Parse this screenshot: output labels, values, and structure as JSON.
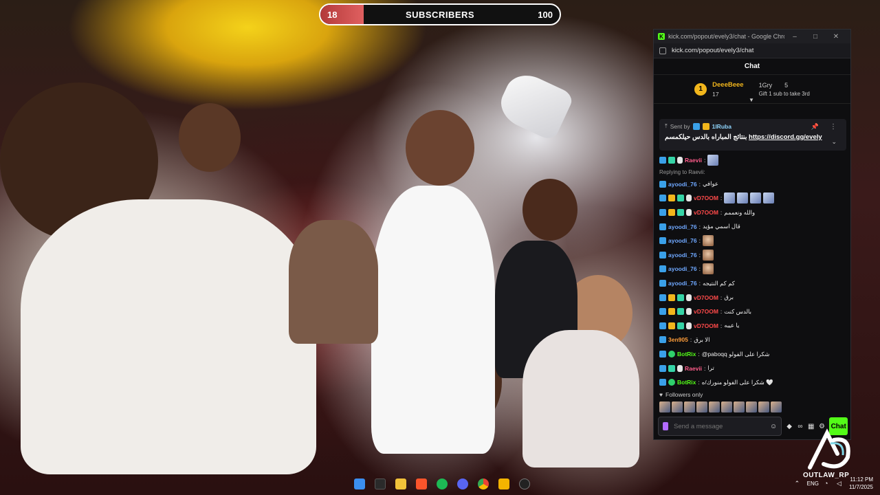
{
  "overlay": {
    "subscribers": {
      "current": "18",
      "label": "SUBSCRIBERS",
      "goal": "100",
      "progress_fraction": 0.18
    }
  },
  "browser": {
    "window_title": "kick.com/popout/evely3/chat - Google Chrome",
    "url": "kick.com/popout/evely3/chat",
    "controls": {
      "minimize": "–",
      "maximize": "□",
      "close": "✕"
    }
  },
  "chat": {
    "header": "Chat",
    "leaderboard": {
      "rank": "1",
      "top_name": "DeeeBeee",
      "top_count": "17",
      "second_name": "1Gry",
      "second_count": "5",
      "gift_text": "Gift 1 sub to take 3rd"
    },
    "pinned": {
      "sent_by_label": "Sent by",
      "user": "1lRuba",
      "message_text": "بنتائج المباراه بالدس حيلكمسم ",
      "link": "https://discord.gg/evely"
    },
    "messages": [
      {
        "user": "Raevii",
        "color": "u-pink",
        "text": "",
        "emotes": 1
      },
      {
        "reply": "Replying to Raevii:",
        "user": "ayoodi_76",
        "color": "u-blue",
        "text": "عوافي"
      },
      {
        "user": "vD7OOM",
        "color": "u-red",
        "text": "",
        "emotes": 4
      },
      {
        "user": "vD7OOM",
        "color": "u-red",
        "text": "والله ونعممم"
      },
      {
        "user": "ayoodi_76",
        "color": "u-blue",
        "text": "قال اسمي مؤيد"
      },
      {
        "user": "ayoodi_76",
        "color": "u-blue",
        "text": "",
        "faces": 1
      },
      {
        "user": "ayoodi_76",
        "color": "u-blue",
        "text": "",
        "faces": 1
      },
      {
        "user": "ayoodi_76",
        "color": "u-blue",
        "text": "",
        "faces": 1
      },
      {
        "user": "ayoodi_76",
        "color": "u-blue",
        "text": "كم كم النتيجه"
      },
      {
        "user": "vD7OOM",
        "color": "u-red",
        "text": "برق"
      },
      {
        "user": "vD7OOM",
        "color": "u-red",
        "text": "بالدس كنت"
      },
      {
        "user": "vD7OOM",
        "color": "u-red",
        "text": "يا عيبه"
      },
      {
        "user": "3en905",
        "color": "u-orange",
        "text": "الا برق"
      },
      {
        "user": "BotRix",
        "color": "u-green",
        "text": "@paboqq شكرا على الفولو"
      },
      {
        "user": "Raevii",
        "color": "u-pink",
        "text": "ترا"
      },
      {
        "user": "BotRix",
        "color": "u-green",
        "text": "شكرا على الفولو منورك/ه 🤍"
      }
    ],
    "followers_only": "Followers only",
    "input_placeholder": "Send a message",
    "send_label": "Chat"
  },
  "watermark": {
    "text": "OUTLAW_RP"
  },
  "taskbar": {
    "lang": "ENG",
    "time": "11:12 PM",
    "date": "11/7/2025"
  },
  "colors": {
    "kick_green": "#53fc18",
    "goal_fill": "#c94747"
  }
}
